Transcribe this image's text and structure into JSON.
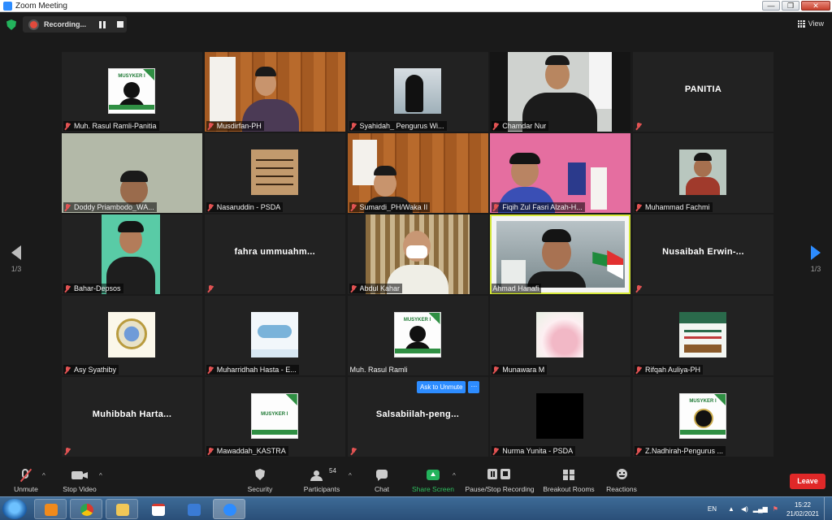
{
  "window": {
    "title": "Zoom Meeting",
    "controls": [
      "—",
      "❐",
      "✕"
    ]
  },
  "top_bar": {
    "recording_label": "Recording...",
    "view_label": "View"
  },
  "pagination": {
    "left": "1/3",
    "right": "1/3"
  },
  "participants": [
    {
      "name": "Muh. Rasul Ramli-Panitia",
      "video": "poster"
    },
    {
      "name": "Musdirfan-PH",
      "video": "camera"
    },
    {
      "name": "Syahidah_ Pengurus Wi...",
      "video": "image"
    },
    {
      "name": "Chamdar Nur",
      "video": "camera"
    },
    {
      "name": "PANITIA",
      "video": "off",
      "display_name": "PANITIA"
    },
    {
      "name": "Doddy Priambodo_WA...",
      "video": "camera"
    },
    {
      "name": "Nasaruddin - PSDA",
      "video": "image"
    },
    {
      "name": "Sumardi_PH/Waka II",
      "video": "camera"
    },
    {
      "name": "Fiqih Zul Fasri Alzah-H...",
      "video": "camera"
    },
    {
      "name": "Muhammad Fachmi",
      "video": "image"
    },
    {
      "name": "Bahar-Depsos",
      "video": "camera"
    },
    {
      "name": "fahra ummuahm...",
      "video": "off",
      "display_name": "fahra  ummuahm..."
    },
    {
      "name": "Abdul Kahar",
      "video": "camera"
    },
    {
      "name": "Ahmad Hanafi",
      "video": "camera",
      "active_speaker": true
    },
    {
      "name": "Nusaibah Erwin-...",
      "video": "off",
      "display_name": "Nusaibah  Erwin-..."
    },
    {
      "name": "Asy Syathiby",
      "video": "image"
    },
    {
      "name": "Muharridhah Hasta - E...",
      "video": "image"
    },
    {
      "name": "Muh. Rasul Ramli",
      "video": "poster"
    },
    {
      "name": "Munawara M",
      "video": "image"
    },
    {
      "name": "Rifqah Auliya-PH",
      "video": "image"
    },
    {
      "name": "Muhibbah Harta...",
      "video": "off",
      "display_name": "Muhibbah  Harta..."
    },
    {
      "name": "Mawaddah_KASTRA",
      "video": "poster"
    },
    {
      "name": "Salsabiilah-peng...",
      "video": "off",
      "display_name": "Salsabiilah-peng..."
    },
    {
      "name": "Nurma Yunita - PSDA",
      "video": "image"
    },
    {
      "name": "Z.Nadhirah-Pengurus ...",
      "video": "image"
    }
  ],
  "poster_title": "MUSYKER I",
  "unmute_prompt": {
    "button": "Ask to Unmute",
    "more": "···"
  },
  "toolbar": {
    "unmute": "Unmute",
    "stop_video": "Stop Video",
    "security": "Security",
    "participants": "Participants",
    "participants_count": "54",
    "chat": "Chat",
    "share_screen": "Share Screen",
    "pause_stop_recording": "Pause/Stop Recording",
    "breakout_rooms": "Breakout Rooms",
    "reactions": "Reactions",
    "leave": "Leave"
  },
  "taskbar": {
    "language": "EN",
    "time": "15:22",
    "date": "21/02/2021"
  },
  "colors": {
    "accent_blue": "#2d8cff",
    "leave_red": "#e02828",
    "active_speaker": "#d6e83a",
    "share_green": "#23b35c"
  }
}
